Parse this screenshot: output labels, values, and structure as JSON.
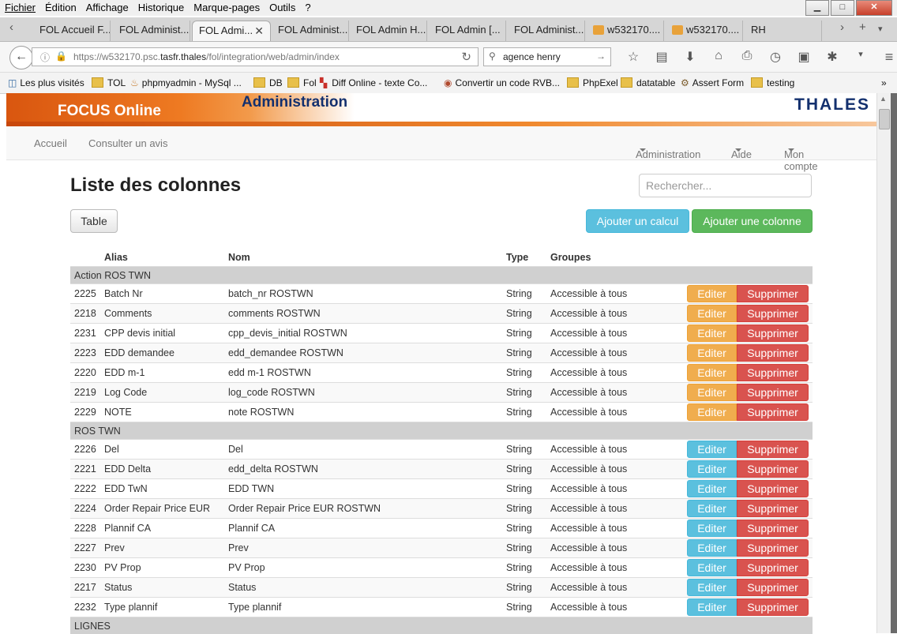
{
  "browser": {
    "menu": [
      "Fichier",
      "Édition",
      "Affichage",
      "Historique",
      "Marque-pages",
      "Outils",
      "?"
    ],
    "tabs": [
      {
        "label": "FOL Accueil F..."
      },
      {
        "label": "FOL Administ..."
      },
      {
        "label": "FOL Admi...",
        "active": true
      },
      {
        "label": "FOL Administ..."
      },
      {
        "label": "FOL Admin H..."
      },
      {
        "label": "FOL Admin [..."
      },
      {
        "label": "FOL Administ..."
      },
      {
        "label": "w532170...."
      },
      {
        "label": "w532170...."
      },
      {
        "label": "RH"
      }
    ],
    "url_prefix": "https://w532170.psc.",
    "url_domain": "tasfr.thales",
    "url_path": "/fol/integration/web/admin/index",
    "search_value": "agence henry",
    "bookmarks": [
      "Les plus visités",
      "TOL",
      "phpmyadmin - MySql ...",
      "DB",
      "Fol",
      "Diff Online - texte Co...",
      "Convertir un code RVB...",
      "PhpExel",
      "datatable",
      "Assert Form",
      "testing"
    ]
  },
  "app": {
    "brand": "FOCUS Online",
    "section": "Administration",
    "company_logo": "THALES",
    "nav_left": [
      "Accueil",
      "Consulter un avis"
    ],
    "nav_right": [
      "Administration",
      "Aide",
      "Mon compte"
    ]
  },
  "page": {
    "title": "Liste des colonnes",
    "search_placeholder": "Rechercher...",
    "table_button": "Table",
    "add_calc_button": "Ajouter un calcul",
    "add_column_button": "Ajouter une colonne",
    "columns": [
      "Alias",
      "Nom",
      "Type",
      "Groupes"
    ],
    "edit_label": "Editer",
    "delete_label": "Supprimer",
    "groups": [
      {
        "name": "Action ROS TWN",
        "edit_color": "#f0ad4e",
        "rows": [
          {
            "id": "2225",
            "alias": "Batch Nr",
            "nom": "batch_nr ROSTWN",
            "type": "String",
            "groupes": "Accessible à tous"
          },
          {
            "id": "2218",
            "alias": "Comments",
            "nom": "comments ROSTWN",
            "type": "String",
            "groupes": "Accessible à tous"
          },
          {
            "id": "2231",
            "alias": "CPP devis initial",
            "nom": "cpp_devis_initial ROSTWN",
            "type": "String",
            "groupes": "Accessible à tous"
          },
          {
            "id": "2223",
            "alias": "EDD demandee",
            "nom": "edd_demandee ROSTWN",
            "type": "String",
            "groupes": "Accessible à tous"
          },
          {
            "id": "2220",
            "alias": "EDD m-1",
            "nom": "edd m-1 ROSTWN",
            "type": "String",
            "groupes": "Accessible à tous"
          },
          {
            "id": "2219",
            "alias": "Log Code",
            "nom": "log_code ROSTWN",
            "type": "String",
            "groupes": "Accessible à tous"
          },
          {
            "id": "2229",
            "alias": "NOTE",
            "nom": "note ROSTWN",
            "type": "String",
            "groupes": "Accessible à tous"
          }
        ]
      },
      {
        "name": "ROS TWN",
        "edit_color": "#5bc0de",
        "rows": [
          {
            "id": "2226",
            "alias": "Del",
            "nom": "Del",
            "type": "String",
            "groupes": "Accessible à tous"
          },
          {
            "id": "2221",
            "alias": "EDD Delta",
            "nom": "edd_delta ROSTWN",
            "type": "String",
            "groupes": "Accessible à tous"
          },
          {
            "id": "2222",
            "alias": "EDD TwN",
            "nom": "EDD TWN",
            "type": "String",
            "groupes": "Accessible à tous"
          },
          {
            "id": "2224",
            "alias": "Order Repair Price EUR",
            "nom": "Order Repair Price EUR ROSTWN",
            "type": "String",
            "groupes": "Accessible à tous"
          },
          {
            "id": "2228",
            "alias": "Plannif CA",
            "nom": "Plannif CA",
            "type": "String",
            "groupes": "Accessible à tous"
          },
          {
            "id": "2227",
            "alias": "Prev",
            "nom": "Prev",
            "type": "String",
            "groupes": "Accessible à tous"
          },
          {
            "id": "2230",
            "alias": "PV Prop",
            "nom": "PV Prop",
            "type": "String",
            "groupes": "Accessible à tous"
          },
          {
            "id": "2217",
            "alias": "Status",
            "nom": "Status",
            "type": "String",
            "groupes": "Accessible à tous"
          },
          {
            "id": "2232",
            "alias": "Type plannif",
            "nom": "Type plannif",
            "type": "String",
            "groupes": "Accessible à tous"
          }
        ]
      },
      {
        "name": "LIGNES",
        "rows": []
      }
    ]
  }
}
